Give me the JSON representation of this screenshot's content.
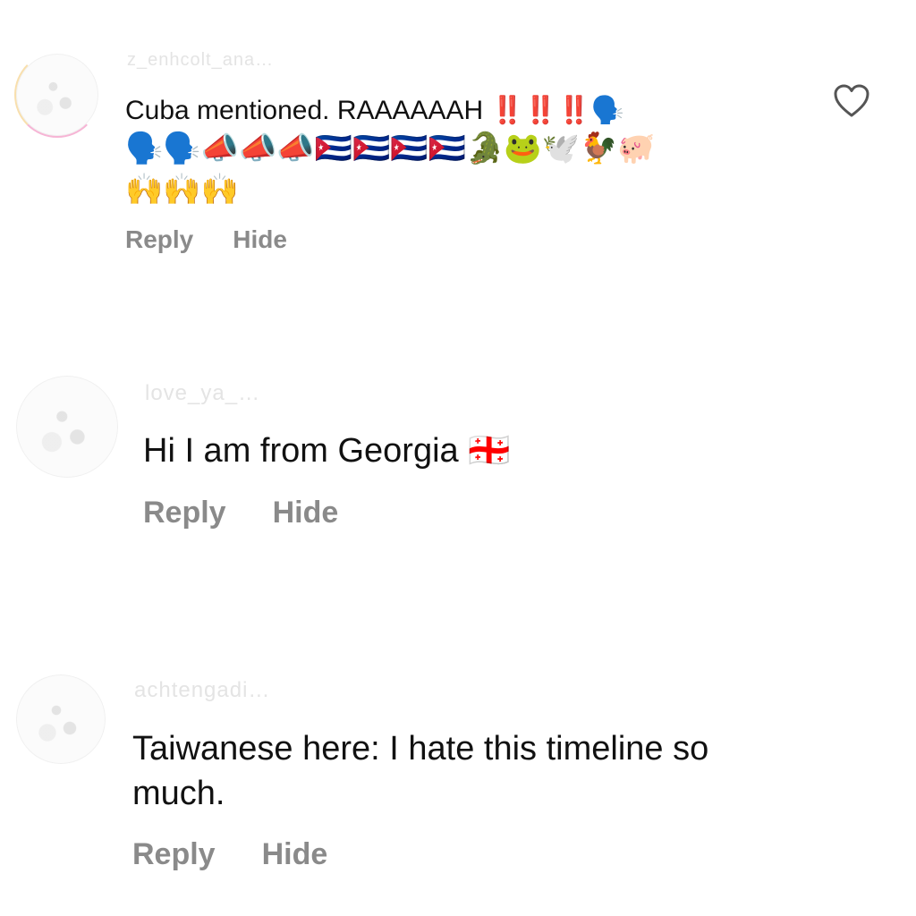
{
  "comments": [
    {
      "username": "z_enhcolt_ana…",
      "text_line1": "Cuba mentioned. RAAAAAAH ‼️‼️‼️🗣️",
      "emoji_line2": "🗣️🗣️📣📣📣🇨🇺🇨🇺🇨🇺🇨🇺🐊🐸🕊️🐓🐖",
      "emoji_line3": "🙌🙌🙌",
      "reply_label": "Reply",
      "hide_label": "Hide"
    },
    {
      "username": "love_ya_…",
      "text": "Hi I am from Georgia 🇬🇪",
      "reply_label": "Reply",
      "hide_label": "Hide"
    },
    {
      "username": "achtengadi…",
      "text": "Taiwanese here: I hate this timeline so\nmuch.",
      "reply_label": "Reply",
      "hide_label": "Hide"
    }
  ],
  "icons": {
    "like": "heart-outline-icon"
  }
}
